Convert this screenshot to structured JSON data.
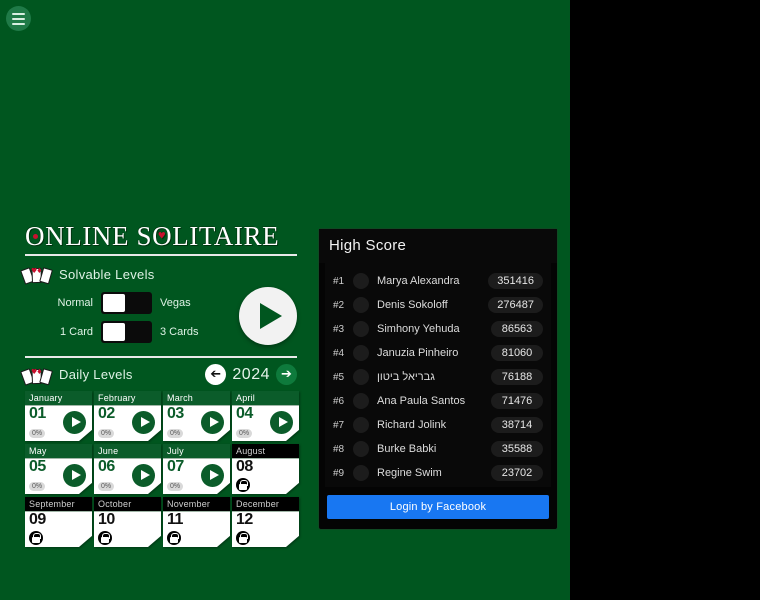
{
  "menu": {
    "icon": "hamburger-icon"
  },
  "logo": {
    "part1": "ONLINE",
    "part2": "SOLITAIRE"
  },
  "solvable": {
    "title": "Solvable Levels",
    "icon": "playing-cards-icon",
    "toggles": [
      {
        "left_label": "Normal",
        "right_label": "Vegas",
        "state": "left"
      },
      {
        "left_label": "1 Card",
        "right_label": "3 Cards",
        "state": "left"
      }
    ],
    "play_label": "play-icon"
  },
  "daily": {
    "title": "Daily Levels",
    "icon": "playing-cards-icon",
    "year": "2024",
    "prev_icon": "arrow-left-icon",
    "next_icon": "arrow-right-icon",
    "months": [
      {
        "name": "January",
        "num": "01",
        "pct": "0%",
        "locked": false
      },
      {
        "name": "February",
        "num": "02",
        "pct": "0%",
        "locked": false
      },
      {
        "name": "March",
        "num": "03",
        "pct": "0%",
        "locked": false
      },
      {
        "name": "April",
        "num": "04",
        "pct": "0%",
        "locked": false
      },
      {
        "name": "May",
        "num": "05",
        "pct": "0%",
        "locked": false
      },
      {
        "name": "June",
        "num": "06",
        "pct": "0%",
        "locked": false
      },
      {
        "name": "July",
        "num": "07",
        "pct": "0%",
        "locked": false
      },
      {
        "name": "August",
        "num": "08",
        "pct": "",
        "locked": true
      },
      {
        "name": "September",
        "num": "09",
        "pct": "",
        "locked": true
      },
      {
        "name": "October",
        "num": "10",
        "pct": "",
        "locked": true
      },
      {
        "name": "November",
        "num": "11",
        "pct": "",
        "locked": true
      },
      {
        "name": "December",
        "num": "12",
        "pct": "",
        "locked": true
      }
    ]
  },
  "high_score": {
    "title": "High Score",
    "rows": [
      {
        "rank": "#1",
        "name": "Marya Alexandra",
        "score": "351416"
      },
      {
        "rank": "#2",
        "name": "Denis Sokoloff",
        "score": "276487"
      },
      {
        "rank": "#3",
        "name": "Simhony Yehuda",
        "score": "86563"
      },
      {
        "rank": "#4",
        "name": "Januzia Pinheiro",
        "score": "81060"
      },
      {
        "rank": "#5",
        "name": "גבריאל ביטון",
        "score": "76188"
      },
      {
        "rank": "#6",
        "name": "Ana Paula Santos",
        "score": "71476"
      },
      {
        "rank": "#7",
        "name": "Richard Jolink",
        "score": "38714"
      },
      {
        "rank": "#8",
        "name": "Burke Babki",
        "score": "35588"
      },
      {
        "rank": "#9",
        "name": "Regine Swim",
        "score": "23702"
      }
    ],
    "login_label": "Login by Facebook"
  },
  "colors": {
    "board_green": "#00561f",
    "dark_green": "#0b5c2a",
    "panel_black": "#040404",
    "facebook_blue": "#1877f2",
    "accent_red": "#c8102e"
  }
}
